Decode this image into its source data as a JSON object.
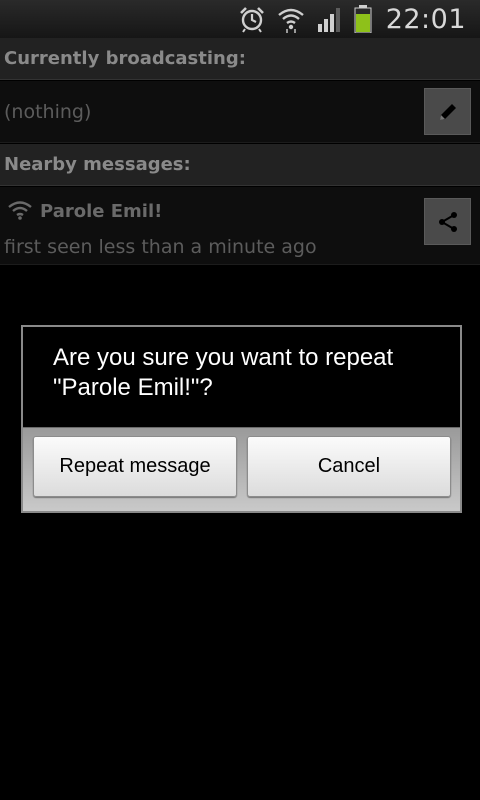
{
  "status_bar": {
    "time": "22:01",
    "icons": [
      "alarm-icon",
      "wifi-icon",
      "signal-icon",
      "battery-icon"
    ],
    "battery_color": "#8ec11a"
  },
  "app": {
    "broadcasting_header": "Currently broadcasting:",
    "broadcasting_value": "(nothing)",
    "edit_icon": "pencil-icon",
    "nearby_header": "Nearby messages:",
    "messages": [
      {
        "icon": "wifi-icon",
        "title": "Parole Emil!",
        "subtitle": "first seen less than a minute ago",
        "action_icon": "share-icon"
      }
    ]
  },
  "dialog": {
    "message": "Are you sure you want to repeat \"Parole Emil!\"?",
    "confirm_label": "Repeat message",
    "cancel_label": "Cancel"
  }
}
